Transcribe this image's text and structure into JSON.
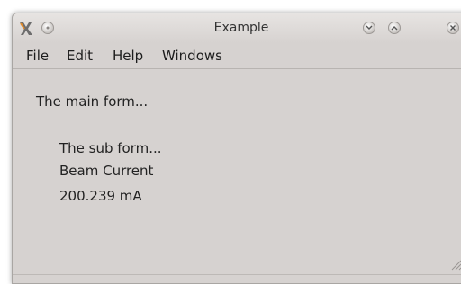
{
  "window": {
    "title": "Example"
  },
  "menu": {
    "items": [
      "File",
      "Edit",
      "Help",
      "Windows"
    ]
  },
  "main_form": {
    "label": "The main form..."
  },
  "sub_form": {
    "label": "The sub form...",
    "field_name": "Beam Current",
    "field_value": "200.239 mA"
  }
}
